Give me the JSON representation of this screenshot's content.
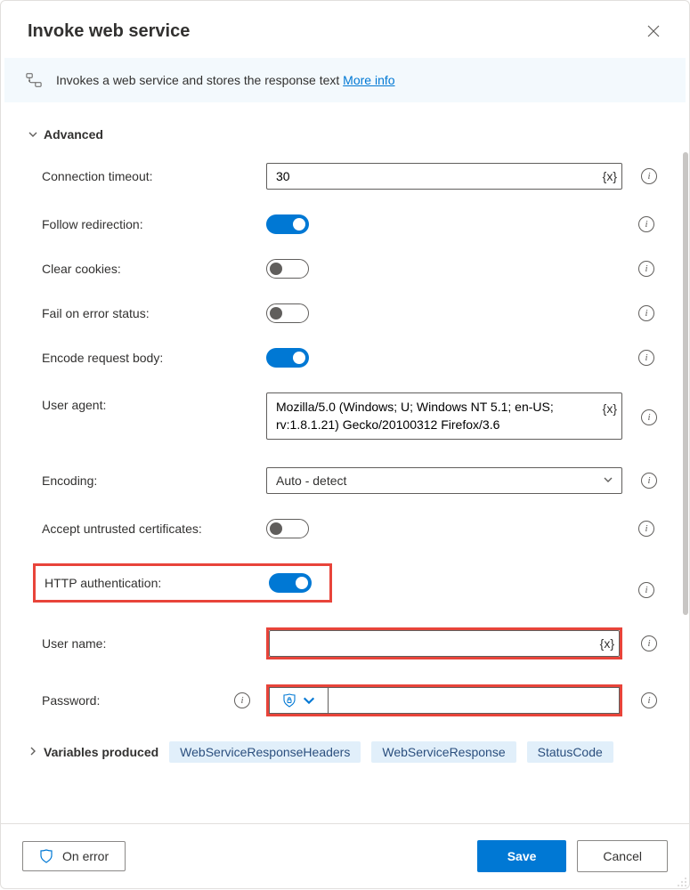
{
  "header": {
    "title": "Invoke web service"
  },
  "banner": {
    "text": "Invokes a web service and stores the response text ",
    "more_info": "More info"
  },
  "sections": {
    "advanced_label": "Advanced",
    "variables_label": "Variables produced"
  },
  "fields": {
    "connection_timeout": {
      "label": "Connection timeout:",
      "value": "30"
    },
    "follow_redirection": {
      "label": "Follow redirection:",
      "on": true
    },
    "clear_cookies": {
      "label": "Clear cookies:",
      "on": false
    },
    "fail_on_error": {
      "label": "Fail on error status:",
      "on": false
    },
    "encode_body": {
      "label": "Encode request body:",
      "on": true
    },
    "user_agent": {
      "label": "User agent:",
      "value": "Mozilla/5.0 (Windows; U; Windows NT 5.1; en-US; rv:1.8.1.21) Gecko/20100312 Firefox/3.6"
    },
    "encoding": {
      "label": "Encoding:",
      "value": "Auto - detect"
    },
    "accept_untrusted": {
      "label": "Accept untrusted certificates:",
      "on": false
    },
    "http_auth": {
      "label": "HTTP authentication:",
      "on": true
    },
    "username": {
      "label": "User name:",
      "value": ""
    },
    "password": {
      "label": "Password:",
      "value": ""
    }
  },
  "var_token": "{x}",
  "variables": [
    "WebServiceResponseHeaders",
    "WebServiceResponse",
    "StatusCode"
  ],
  "footer": {
    "on_error": "On error",
    "save": "Save",
    "cancel": "Cancel"
  }
}
